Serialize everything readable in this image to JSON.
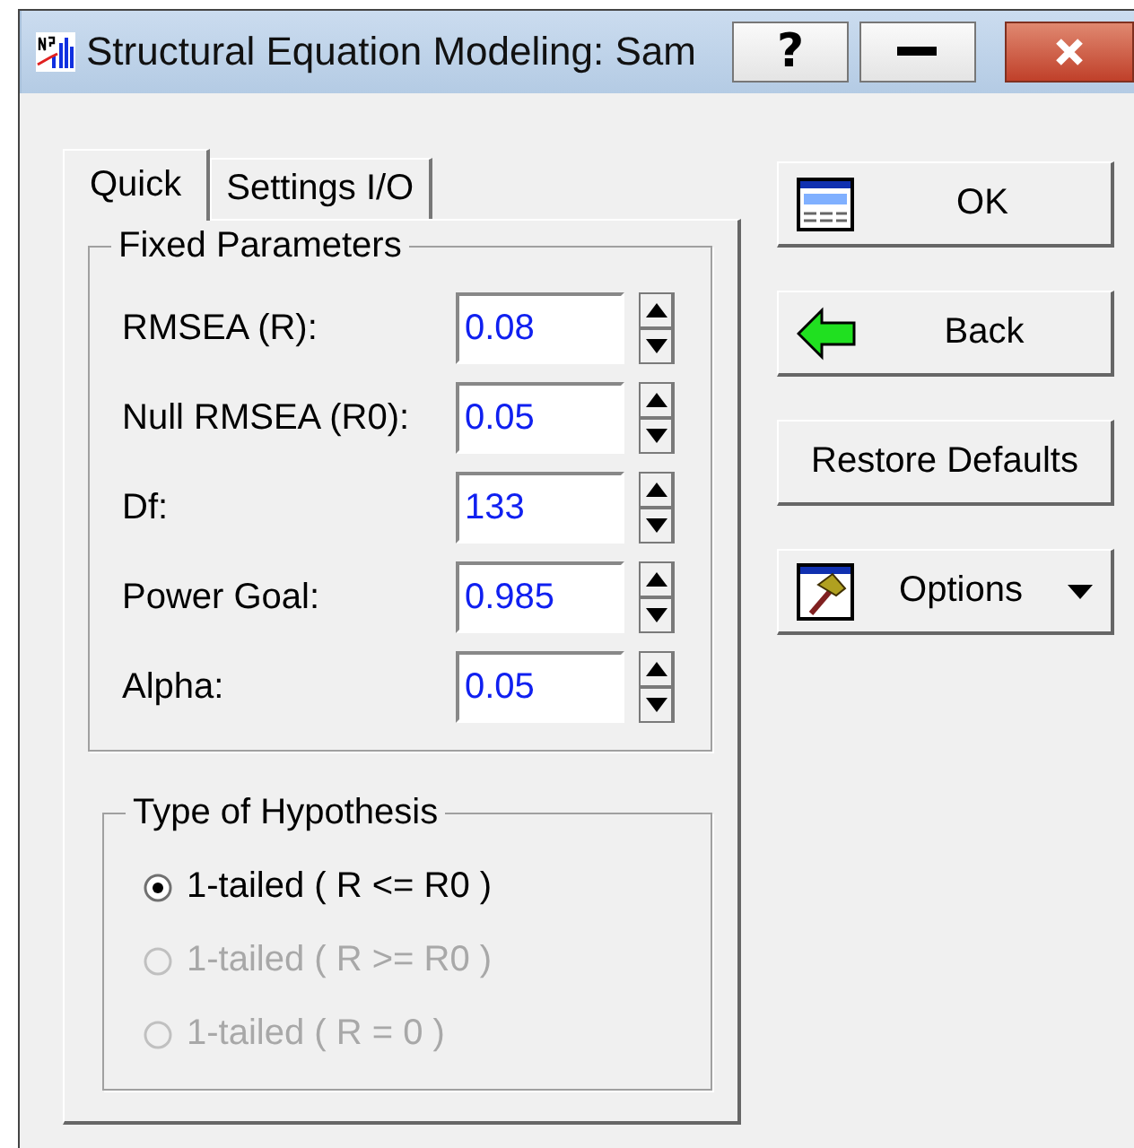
{
  "window": {
    "title": "Structural Equation Modeling: Sam",
    "help": "?"
  },
  "tabs": [
    {
      "label": "Quick",
      "selected": true
    },
    {
      "label": "Settings I/O",
      "selected": false
    }
  ],
  "fixed_parameters": {
    "title": "Fixed Parameters",
    "fields": [
      {
        "label": "RMSEA (R):",
        "value": "0.08"
      },
      {
        "label": "Null RMSEA (R0):",
        "value": "0.05"
      },
      {
        "label": "Df:",
        "value": "133"
      },
      {
        "label": "Power Goal:",
        "value": "0.985"
      },
      {
        "label": "Alpha:",
        "value": "0.05"
      }
    ]
  },
  "hypothesis": {
    "title": "Type of Hypothesis",
    "options": [
      {
        "label": "1-tailed ( R <= R0 )",
        "selected": true,
        "disabled": false
      },
      {
        "label": "1-tailed ( R >= R0 )",
        "selected": false,
        "disabled": true
      },
      {
        "label": "1-tailed ( R = 0 )",
        "selected": false,
        "disabled": true
      }
    ]
  },
  "buttons": [
    {
      "label": "OK",
      "kind": "ok"
    },
    {
      "label": "Back",
      "kind": "back"
    },
    {
      "label": "Restore Defaults",
      "kind": "plain"
    },
    {
      "label": "Options",
      "kind": "dropdown"
    }
  ]
}
